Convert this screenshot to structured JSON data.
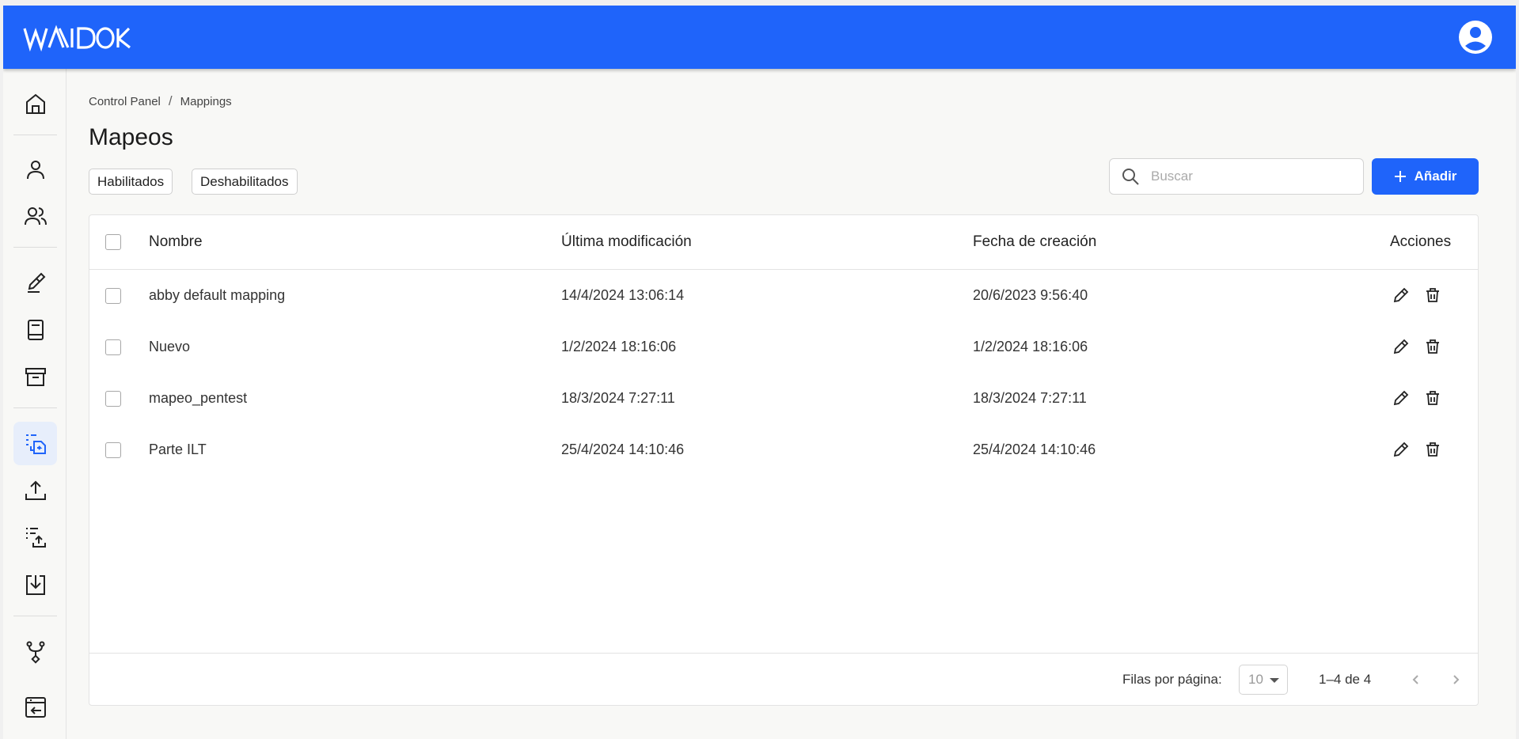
{
  "header": {
    "logo_text": "WAIDOK",
    "account_icon": "account-circle-icon",
    "brand_color": "#1f64fa"
  },
  "sidebar": {
    "items": [
      {
        "name": "home",
        "icon": "home-icon"
      },
      {
        "name": "user",
        "icon": "user-icon"
      },
      {
        "name": "users",
        "icon": "users-icon"
      },
      {
        "name": "edit-document",
        "icon": "document-edit-icon"
      },
      {
        "name": "book",
        "icon": "book-icon"
      },
      {
        "name": "archive",
        "icon": "archive-icon"
      },
      {
        "name": "mappings",
        "icon": "mapping-icon",
        "active": true
      },
      {
        "name": "upload",
        "icon": "upload-icon"
      },
      {
        "name": "list-upload",
        "icon": "list-upload-icon"
      },
      {
        "name": "download",
        "icon": "download-icon"
      },
      {
        "name": "workflow",
        "icon": "workflow-icon"
      },
      {
        "name": "export",
        "icon": "window-export-icon"
      }
    ]
  },
  "breadcrumb": {
    "items": [
      "Control Panel",
      "Mappings"
    ],
    "separator": "/"
  },
  "page": {
    "title": "Mapeos"
  },
  "filters": {
    "enabled_label": "Habilitados",
    "disabled_label": "Deshabilitados"
  },
  "search": {
    "placeholder": "Buscar",
    "value": ""
  },
  "toolbar": {
    "add_label": "Añadir"
  },
  "table": {
    "columns": {
      "name": "Nombre",
      "modified": "Última modificación",
      "created": "Fecha de creación",
      "actions": "Acciones"
    },
    "rows": [
      {
        "name": "abby default mapping",
        "modified": "14/4/2024 13:06:14",
        "created": "20/6/2023 9:56:40"
      },
      {
        "name": "Nuevo",
        "modified": "1/2/2024 18:16:06",
        "created": "1/2/2024 18:16:06"
      },
      {
        "name": "mapeo_pentest",
        "modified": "18/3/2024 7:27:11",
        "created": "18/3/2024 7:27:11"
      },
      {
        "name": "Parte ILT",
        "modified": "25/4/2024 14:10:46",
        "created": "25/4/2024 14:10:46"
      }
    ]
  },
  "pagination": {
    "rows_per_page_label": "Filas por página:",
    "rows_per_page_value": "10",
    "range_text": "1–4 de 4"
  }
}
